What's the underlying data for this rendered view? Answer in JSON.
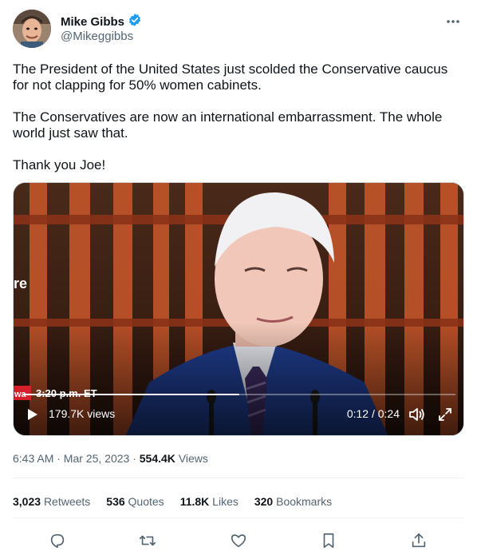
{
  "author": {
    "display_name": "Mike Gibbs",
    "handle": "@Mikeggibbs",
    "verified_icon": "verified-badge-icon",
    "verified_color": "#1d9bf0"
  },
  "tweet": {
    "paragraphs": [
      "The President of the United States just scolded the Conservative caucus for not clapping for 50% women cabinets.",
      "The Conservatives are now an international embarrassment. The whole world just saw that.",
      "Thank you Joe!"
    ]
  },
  "video": {
    "chyron_text": "3:20 p.m. ET",
    "side_text": "re",
    "views": "179.7K views",
    "time": "0:12 / 0:24",
    "progress_fraction": 0.5
  },
  "meta": {
    "timestamp": "6:43 AM · Mar 25, 2023",
    "separator": " · ",
    "views_count": "554.4K",
    "views_label": "Views"
  },
  "stats": {
    "retweets_count": "3,023",
    "retweets_label": "Retweets",
    "quotes_count": "536",
    "quotes_label": "Quotes",
    "likes_count": "11.8K",
    "likes_label": "Likes",
    "bookmarks_count": "320",
    "bookmarks_label": "Bookmarks"
  },
  "actions": {
    "icons": [
      "reply-icon",
      "retweet-icon",
      "like-icon",
      "bookmark-icon",
      "share-icon"
    ]
  },
  "colors": {
    "text_primary": "#0f1419",
    "text_secondary": "#536471",
    "accent": "#1d9bf0"
  }
}
